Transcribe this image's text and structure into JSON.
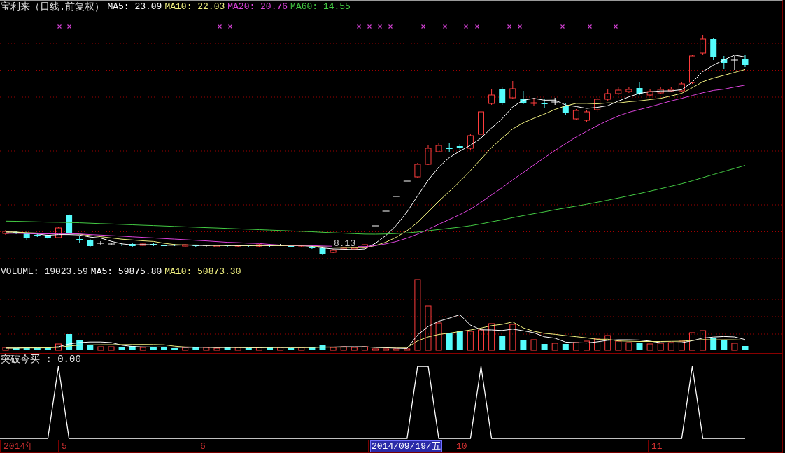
{
  "price_panel": {
    "title": "宝利来（日线.前复权）",
    "indicators": [
      {
        "text": "MA5: 23.09",
        "color": "#ffffff"
      },
      {
        "text": "MA10: 22.03",
        "color": "#f0f080"
      },
      {
        "text": "MA20: 20.76",
        "color": "#dd44dd"
      },
      {
        "text": "MA60: 14.55",
        "color": "#44cc44"
      }
    ],
    "low_label": "8.13"
  },
  "volume_panel": {
    "indicators": [
      {
        "text": "VOLUME: 19023.59",
        "color": "#e8e8e8"
      },
      {
        "text": "MA5: 59875.80",
        "color": "#ffffff"
      },
      {
        "text": "MA10: 50873.30",
        "color": "#f0f080"
      }
    ]
  },
  "signal_panel": {
    "label": "突破今买 : 0.00"
  },
  "time_axis": {
    "labels": [
      {
        "text": "2014年",
        "selected": false
      },
      {
        "text": "5",
        "selected": false
      },
      {
        "text": "6",
        "selected": false
      },
      {
        "text": "2014/09/19/五",
        "selected": true
      },
      {
        "text": "10",
        "selected": false
      },
      {
        "text": "11",
        "selected": false
      }
    ]
  }
}
